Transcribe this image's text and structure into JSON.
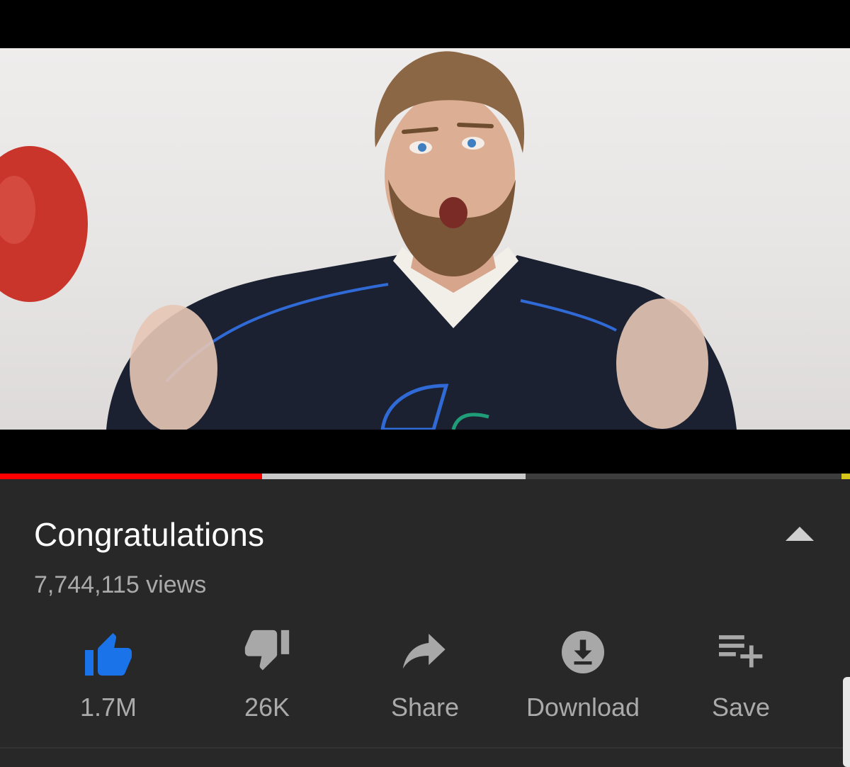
{
  "video": {
    "title": "Congratulations",
    "views_text": "7,744,115 views",
    "progress": {
      "played_fraction": 0.308,
      "buffered_fraction": 0.618
    }
  },
  "actions": [
    {
      "id": "like",
      "label": "1.7M",
      "icon": "thumb-up-icon",
      "color": "#1a73e8"
    },
    {
      "id": "dislike",
      "label": "26K",
      "icon": "thumb-down-icon",
      "color": "#a8a8a8"
    },
    {
      "id": "share",
      "label": "Share",
      "icon": "share-arrow-icon",
      "color": "#a8a8a8"
    },
    {
      "id": "download",
      "label": "Download",
      "icon": "download-icon",
      "color": "#a8a8a8"
    },
    {
      "id": "save",
      "label": "Save",
      "icon": "playlist-add-icon",
      "color": "#a8a8a8"
    }
  ],
  "colors": {
    "background": "#282828",
    "progress_played": "#ff0000",
    "progress_buffered": "#c9c9c9",
    "title_text": "#ffffff",
    "secondary_text": "#aaaaaa",
    "accent_like": "#1a73e8"
  },
  "icons": {
    "collapse": "chevron-up-icon"
  }
}
